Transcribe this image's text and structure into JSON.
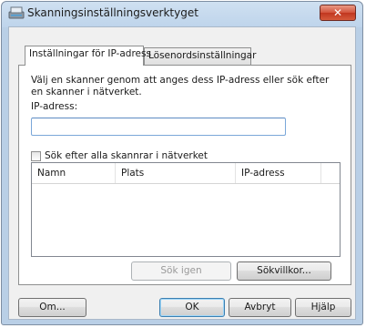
{
  "window": {
    "title": "Skanningsinställningsverktyget",
    "close_label": "✕"
  },
  "tabs": [
    {
      "label": "Inställningar för IP-adress",
      "active": true
    },
    {
      "label": "Lösenordsinställningar",
      "active": false
    }
  ],
  "ip_tab": {
    "instruction": "Välj en skanner genom att anges dess IP-adress eller sök efter en skanner i nätverket.",
    "ip_label": "IP-adress:",
    "ip_value": "",
    "search_all_checkbox_label": "Sök efter alla skannrar i nätverket",
    "search_all_checked": false,
    "columns": [
      "Namn",
      "Plats",
      "IP-adress"
    ],
    "rows": [],
    "search_again_button": "Sök igen",
    "search_conditions_button": "Sökvillkor..."
  },
  "footer": {
    "about_button": "Om...",
    "ok_button": "OK",
    "cancel_button": "Avbryt",
    "help_button": "Hjälp"
  }
}
